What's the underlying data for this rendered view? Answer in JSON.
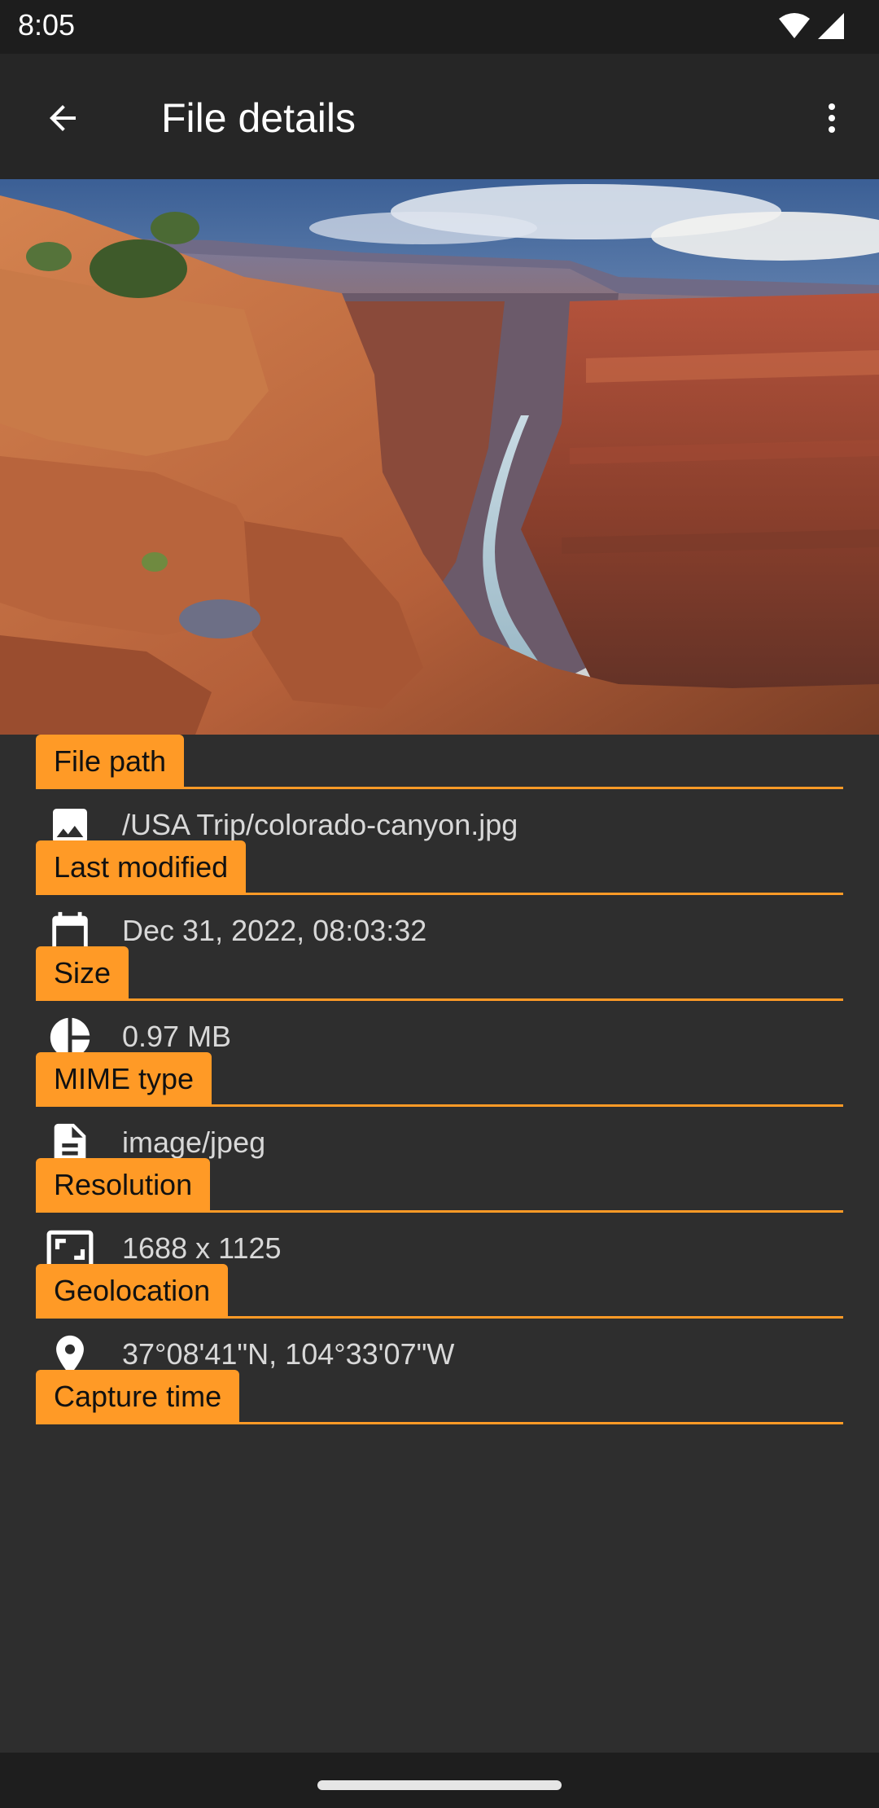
{
  "status_bar": {
    "time": "8:05",
    "icons": [
      "wifi-icon",
      "signal-icon"
    ]
  },
  "app_bar": {
    "title": "File details",
    "back_icon": "arrow-back-icon",
    "menu_icon": "more-vert-icon"
  },
  "hero": {
    "subject": "canyon-photo"
  },
  "colors": {
    "accent": "#ff9a26",
    "background": "#2e2e2e",
    "app_bar": "#262626",
    "status_bar": "#1d1d1d"
  },
  "details": [
    {
      "label": "File path",
      "value": "/USA Trip/colorado-canyon.jpg",
      "icon": "image-icon"
    },
    {
      "label": "Last modified",
      "value": "Dec 31, 2022, 08:03:32",
      "icon": "calendar-icon"
    },
    {
      "label": "Size",
      "value": "0.97 MB",
      "icon": "pie-chart-icon"
    },
    {
      "label": "MIME type",
      "value": "image/jpeg",
      "icon": "document-icon"
    },
    {
      "label": "Resolution",
      "value": "1688 x 1125",
      "icon": "aspect-ratio-icon"
    },
    {
      "label": "Geolocation",
      "value": "37°08'41\"N, 104°33'07\"W",
      "icon": "location-pin-icon"
    },
    {
      "label": "Capture time",
      "value": "",
      "icon": ""
    }
  ]
}
